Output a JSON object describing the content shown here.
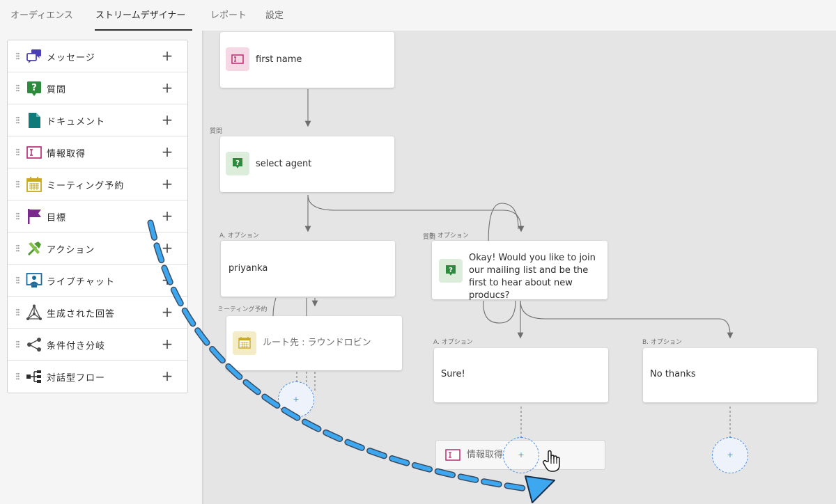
{
  "tabs": [
    {
      "label": "オーディエンス",
      "active": false
    },
    {
      "label": "ストリームデザイナー",
      "active": true
    },
    {
      "label": "レポート",
      "active": false
    },
    {
      "label": "設定",
      "active": false
    }
  ],
  "palette": {
    "items": [
      {
        "label": "メッセージ",
        "icon": "message-icon"
      },
      {
        "label": "質問",
        "icon": "question-icon"
      },
      {
        "label": "ドキュメント",
        "icon": "document-icon"
      },
      {
        "label": "情報取得",
        "icon": "form-field-icon"
      },
      {
        "label": "ミーティング予約",
        "icon": "calendar-icon"
      },
      {
        "label": "目標",
        "icon": "flag-icon"
      },
      {
        "label": "アクション",
        "icon": "tools-icon"
      },
      {
        "label": "ライブチャット",
        "icon": "live-chat-icon"
      },
      {
        "label": "生成された回答",
        "icon": "generated-answer-icon"
      },
      {
        "label": "条件付き分岐",
        "icon": "branch-icon"
      },
      {
        "label": "対話型フロー",
        "icon": "flow-icon"
      }
    ],
    "add_symbol": "+"
  },
  "canvas": {
    "nodes": {
      "first_name": {
        "text": "first name"
      },
      "select_agent": {
        "caption": "質問",
        "text": "select agent"
      },
      "priyanka": {
        "caption": "A. オプション",
        "text": "priyanka"
      },
      "okay_question": {
        "caption_overlap_a": "質問",
        "caption_overlap_b": "B. オプション",
        "text": "Okay! Would you like to join our mailing list and be the first to hear about new producs?"
      },
      "meeting": {
        "caption": "ミーティング予約",
        "text": "ルート先 : ラウンドロビン"
      },
      "sure": {
        "caption": "A. オプション",
        "text": "Sure!"
      },
      "no_thanks": {
        "caption": "B. オプション",
        "text": "No thanks"
      },
      "drag_ghost": {
        "text": "情報取得"
      }
    },
    "add_symbol": "+"
  },
  "colors": {
    "accent_blue": "#4a8fe0",
    "drag_arrow": "#3da7ef",
    "message_icon": "#4b3fb5",
    "question_icon": "#2e8b3d",
    "document_icon": "#0f7a7a",
    "form_icon": "#b4206c",
    "calendar_icon": "#c9a823",
    "flag_icon": "#7a2a8c",
    "tools_icon": "#4f9a2b",
    "live_chat_icon": "#1a6c9e"
  }
}
